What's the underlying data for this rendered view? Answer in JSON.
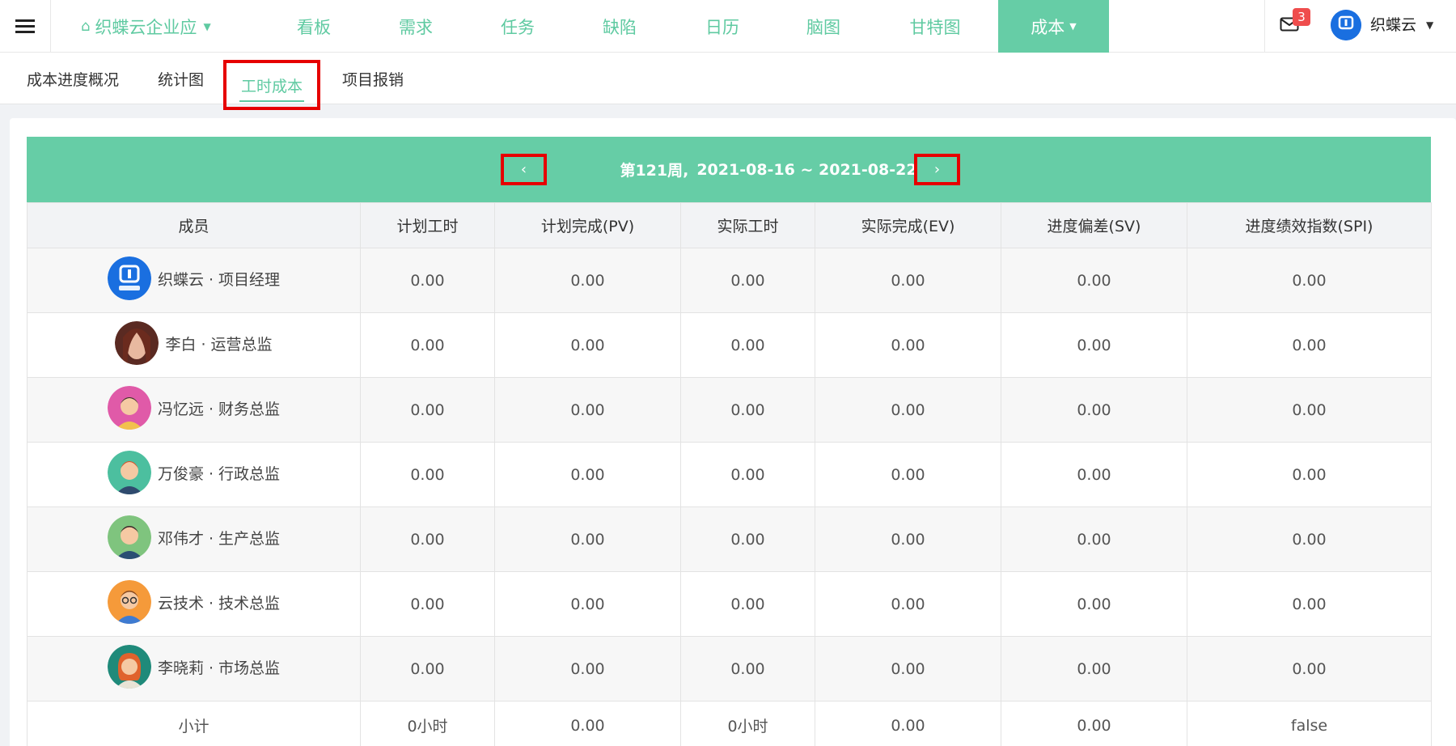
{
  "topbar": {
    "brand_label": "织蝶云企业应",
    "nav": [
      "看板",
      "需求",
      "任务",
      "缺陷",
      "日历",
      "脑图",
      "甘特图"
    ],
    "active_nav": "成本",
    "mail_count": "3",
    "user_name": "织蝶云"
  },
  "subtabs": [
    "成本进度概况",
    "统计图",
    "工时成本",
    "项目报销"
  ],
  "week": {
    "label": "第121周,",
    "range": "2021-08-16 ~ 2021-08-22",
    "prev": "‹",
    "next": "›"
  },
  "table": {
    "headers": [
      "成员",
      "计划工时",
      "计划完成(PV)",
      "实际工时",
      "实际完成(EV)",
      "进度偏差(SV)",
      "进度绩效指数(SPI)"
    ],
    "rows": [
      {
        "member": "织蝶云 · 项目经理",
        "avatar": "logo",
        "values": [
          "0.00",
          "0.00",
          "0.00",
          "0.00",
          "0.00",
          "0.00"
        ]
      },
      {
        "member": "李白 · 运营总监",
        "avatar": "photo",
        "values": [
          "0.00",
          "0.00",
          "0.00",
          "0.00",
          "0.00",
          "0.00"
        ]
      },
      {
        "member": "冯忆远 · 财务总监",
        "avatar": "pink",
        "values": [
          "0.00",
          "0.00",
          "0.00",
          "0.00",
          "0.00",
          "0.00"
        ]
      },
      {
        "member": "万俊豪 · 行政总监",
        "avatar": "teal",
        "values": [
          "0.00",
          "0.00",
          "0.00",
          "0.00",
          "0.00",
          "0.00"
        ]
      },
      {
        "member": "邓伟才 · 生产总监",
        "avatar": "green",
        "values": [
          "0.00",
          "0.00",
          "0.00",
          "0.00",
          "0.00",
          "0.00"
        ]
      },
      {
        "member": "云技术 · 技术总监",
        "avatar": "orange",
        "values": [
          "0.00",
          "0.00",
          "0.00",
          "0.00",
          "0.00",
          "0.00"
        ]
      },
      {
        "member": "李晓莉 · 市场总监",
        "avatar": "darkteal",
        "values": [
          "0.00",
          "0.00",
          "0.00",
          "0.00",
          "0.00",
          "0.00"
        ]
      }
    ],
    "subtotal": {
      "label": "小计",
      "values": [
        "0小时",
        "0.00",
        "0小时",
        "0.00",
        "0.00",
        "false"
      ]
    }
  },
  "colors": {
    "accent": "#66cda6",
    "highlight": "#e60000",
    "badge": "#ef4d4d"
  }
}
